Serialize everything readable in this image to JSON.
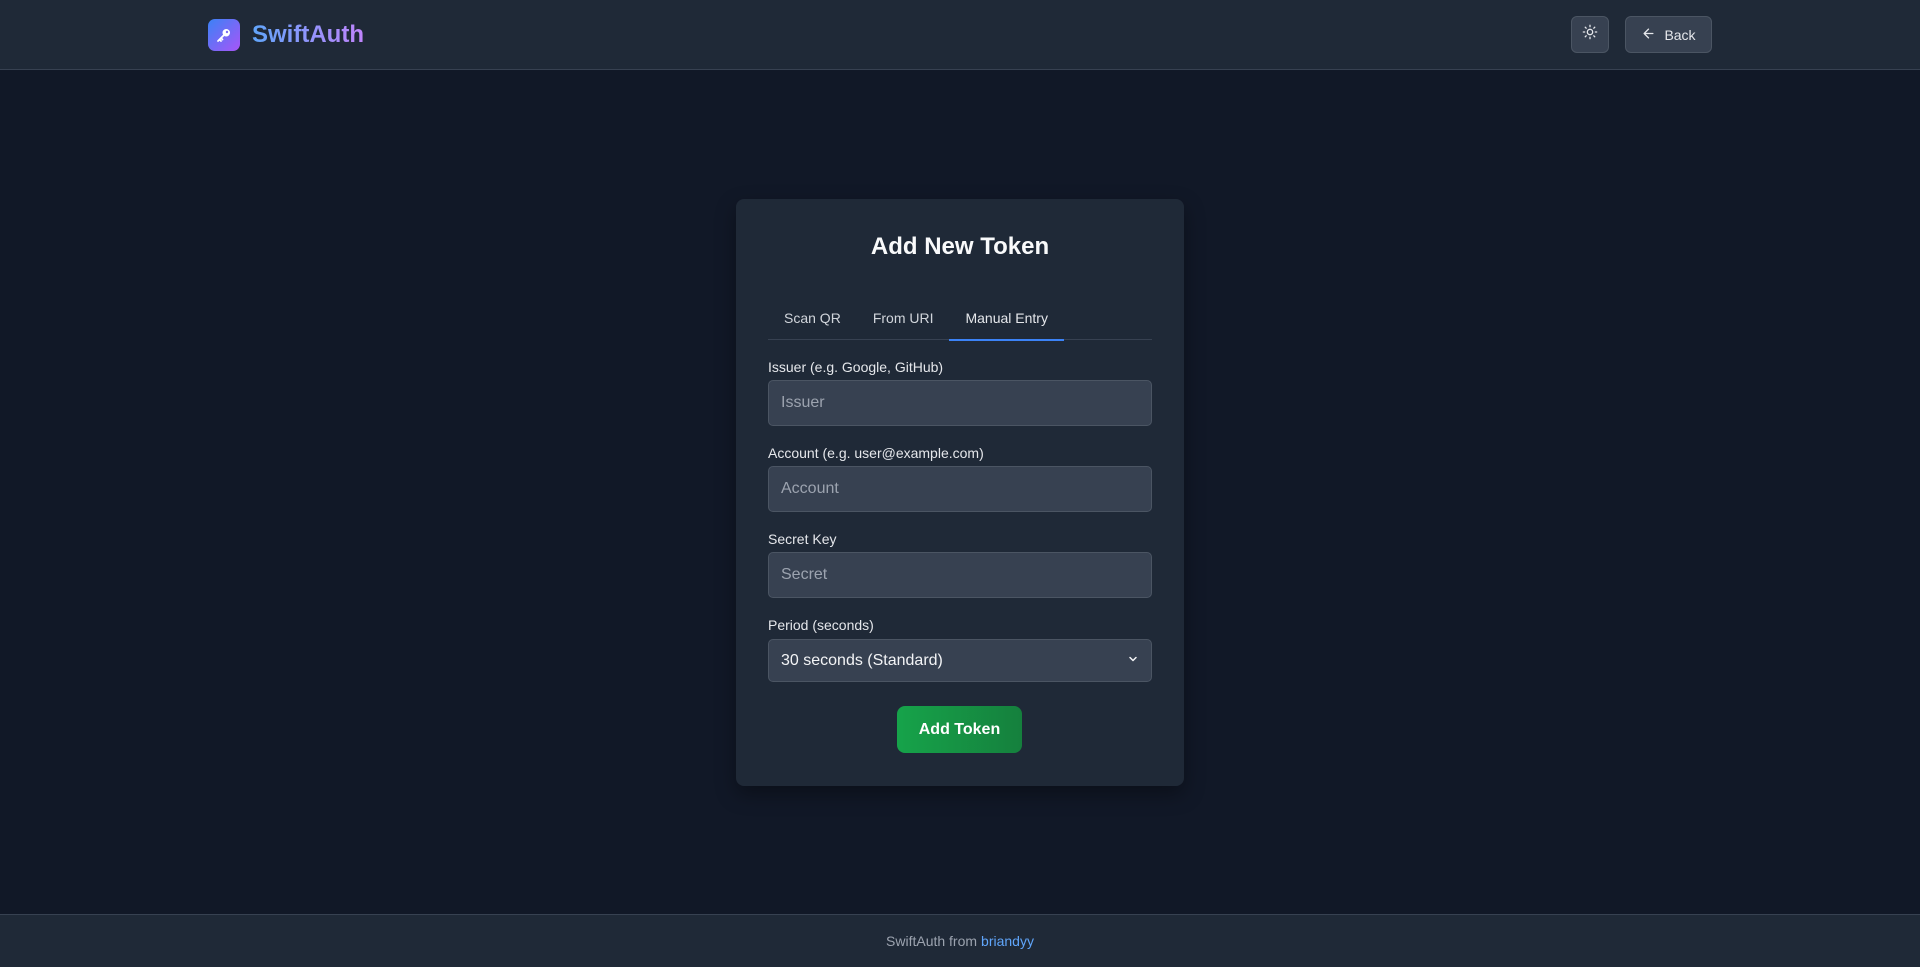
{
  "header": {
    "brand_name": "SwiftAuth",
    "logo_icon": "key-icon",
    "theme_icon": "sun-icon",
    "back_label": "Back"
  },
  "card": {
    "title": "Add New Token",
    "tabs": [
      {
        "label": "Scan QR",
        "active": false
      },
      {
        "label": "From URI",
        "active": false
      },
      {
        "label": "Manual Entry",
        "active": true
      }
    ],
    "fields": {
      "issuer": {
        "label": "Issuer (e.g. Google, GitHub)",
        "placeholder": "Issuer",
        "value": ""
      },
      "account": {
        "label": "Account (e.g. user@example.com)",
        "placeholder": "Account",
        "value": ""
      },
      "secret": {
        "label": "Secret Key",
        "placeholder": "Secret",
        "value": ""
      },
      "period": {
        "label": "Period (seconds)",
        "selected": "30 seconds (Standard)"
      }
    },
    "submit_label": "Add Token"
  },
  "footer": {
    "text": "SwiftAuth from",
    "link": "briandyy"
  },
  "colors": {
    "background": "#111827",
    "surface": "#1f2937",
    "accent": "#3b82f6",
    "success": "#16a34a"
  }
}
